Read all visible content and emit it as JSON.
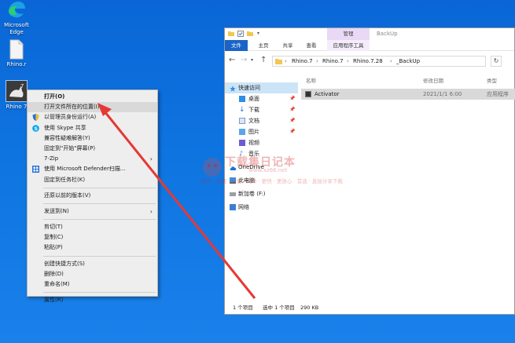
{
  "desktop": {
    "icons": [
      {
        "label": "Microsoft Edge"
      },
      {
        "label": "Rhino.r"
      },
      {
        "label": "Rhino 7"
      }
    ]
  },
  "context_menu": {
    "items": [
      {
        "label": "打开(O)",
        "bold": true
      },
      {
        "label": "打开文件所在的位置(I)",
        "highlighted": true
      },
      {
        "label": "以管理员身份运行(A)",
        "icon": "shield-icon"
      },
      {
        "label": "使用 Skype 共享",
        "icon": "skype-icon"
      },
      {
        "label": "兼容性疑难解答(Y)"
      },
      {
        "label": "固定到\"开始\"屏幕(P)"
      },
      {
        "label": "7-Zip",
        "submenu": true
      },
      {
        "label": "使用 Microsoft Defender扫描...",
        "icon": "defender-icon"
      },
      {
        "label": "固定到任务栏(K)"
      },
      {
        "label": "还原以前的版本(V)"
      },
      {
        "label": "发送到(N)",
        "submenu": true
      },
      {
        "label": "剪切(T)"
      },
      {
        "label": "复制(C)"
      },
      {
        "label": "粘贴(P)"
      },
      {
        "label": "创建快捷方式(S)"
      },
      {
        "label": "删除(D)"
      },
      {
        "label": "重命名(M)"
      },
      {
        "label": "属性(R)"
      }
    ]
  },
  "explorer": {
    "title": "BackUp",
    "ribbon_group": "管理",
    "tabs": [
      "文件",
      "主页",
      "共享",
      "查看",
      "应用程序工具"
    ],
    "breadcrumb": [
      "Rhino.7",
      "Rhino.7",
      "Rhino.7.28",
      "_BackUp"
    ],
    "sidebar": [
      {
        "label": "快速访问",
        "icon": "star-icon",
        "pinned": false,
        "selected": true
      },
      {
        "label": "桌面",
        "icon": "desktop-icon",
        "pinned": true
      },
      {
        "label": "下载",
        "icon": "download-icon",
        "pinned": true
      },
      {
        "label": "文档",
        "icon": "document-icon",
        "pinned": true
      },
      {
        "label": "图片",
        "icon": "picture-icon",
        "pinned": true
      },
      {
        "label": "视频",
        "icon": "video-icon"
      },
      {
        "label": "音乐",
        "icon": "music-icon"
      },
      {
        "label": "OneDrive",
        "icon": "cloud-icon"
      },
      {
        "label": "此电脑",
        "icon": "computer-icon"
      },
      {
        "label": "新加卷 (F:)",
        "icon": "drive-icon"
      },
      {
        "label": "网络",
        "icon": "network-icon"
      }
    ],
    "columns": {
      "name": "名称",
      "modified": "修改日期",
      "type": "类型"
    },
    "file": {
      "name": "Activator",
      "modified": "2021/1/1 6:00",
      "type": "应用程序"
    },
    "status": {
      "count": "1 个项目",
      "selected": "选中 1 个项目",
      "size": "290 KB"
    }
  },
  "watermark": {
    "big": "下载集日记本",
    "url": "www.xz66.net",
    "small": "软件 · 免费 · 绿色 · 纯净 · 更快 · 更放心 · 首选 · 直接分享下载"
  },
  "colors": {
    "desktop": "#0e74e0",
    "annotation_arrow": "#e53935",
    "file_tab": "#1a64c8",
    "app_tools_tab": "#e9d9f5",
    "selection": "#cce4f7"
  }
}
